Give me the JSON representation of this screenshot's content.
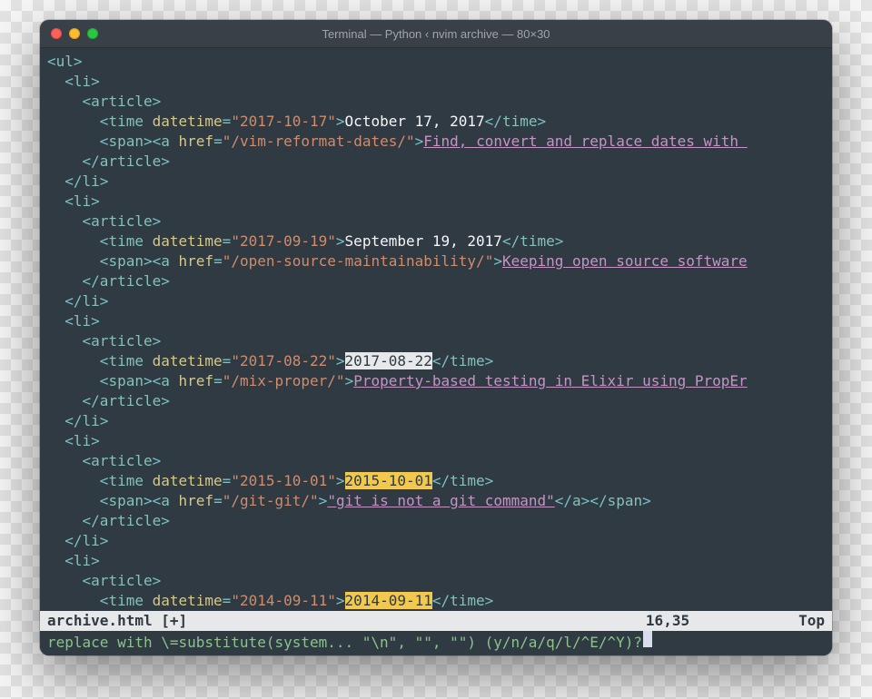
{
  "window": {
    "title": "Terminal — Python ‹ nvim archive — 80×30"
  },
  "code": {
    "ul_open": "ul",
    "li": "li",
    "article": "article",
    "time": "time",
    "span": "span",
    "a": "a",
    "datetime_attr": "datetime",
    "href_attr": "href",
    "items": [
      {
        "datetime": "\"2017-10-17\"",
        "date_text": "October 17, 2017",
        "href": "\"/vim-reformat-dates/\"",
        "link_text": "Find, convert and replace dates with ",
        "date_highlight": "none",
        "closes_a": false,
        "closes_span": false
      },
      {
        "datetime": "\"2017-09-19\"",
        "date_text": "September 19, 2017",
        "href": "\"/open-source-maintainability/\"",
        "link_text": "Keeping open source software",
        "date_highlight": "none",
        "closes_a": false,
        "closes_span": false
      },
      {
        "datetime": "\"2017-08-22\"",
        "date_text": "2017-08-22",
        "href": "\"/mix-proper/\"",
        "link_text": "Property-based testing in Elixir using PropEr",
        "date_highlight": "sel",
        "closes_a": false,
        "closes_span": false
      },
      {
        "datetime": "\"2015-10-01\"",
        "date_text": "2015-10-01",
        "href": "\"/git-git/\"",
        "link_text": "\"git is not a git command\"",
        "date_highlight": "hl",
        "closes_a": true,
        "closes_span": true
      }
    ],
    "tail": {
      "datetime": "\"2014-09-11\"",
      "date_text": "2014-09-11",
      "date_highlight": "hl"
    }
  },
  "status": {
    "filename": "archive.html [+]",
    "position": "16,35",
    "scroll": "Top"
  },
  "cmd": {
    "text": "replace with \\=substitute(system... \"\\n\", \"\", \"\") (y/n/a/q/l/^E/^Y)?"
  }
}
